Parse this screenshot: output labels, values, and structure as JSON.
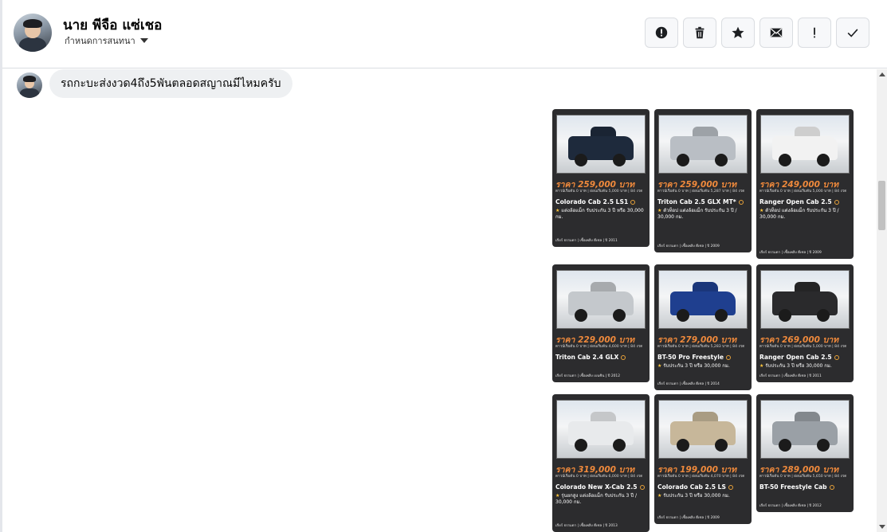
{
  "header": {
    "name": "นาย พีจือ แซ่เชอ",
    "subtitle": "กำหนดการสนทนา"
  },
  "messages": [
    {
      "text": "รถกะบะส่งงวด4ถึง5พันตลอดสญาณมีไหมครับ"
    }
  ],
  "cars": [
    {
      "price": "ราคา 259,000 บาท",
      "finance": "ดาวน์เริ่มต้น 0 บาท | ผ่อนเริ่มต้น 5,000 บาท | 84 งวด",
      "model": "Colorado Cab 2.5 LS1",
      "feature": "แต่งล้อแม็ก รับประกัน 3 ปี หรือ 30,000 กม.",
      "footer": "เกียร์ ธรรมดา | เชื้อเพลิง ดีเซล | ปี 2011",
      "body_color": "#1e2a3c"
    },
    {
      "price": "ราคา 259,000 บาท",
      "finance": "ดาวน์เริ่มต้น 0 บาท | ผ่อนเริ่มต้น 5,287 บาท | 84 งวด",
      "model": "Triton Cab 2.5 GLX MT*",
      "feature": "ตัวท็อป แต่งล้อแม็ก รับประกัน 3 ปี / 30,000 กม.",
      "footer": "เกียร์ ธรรมดา | เชื้อเพลิง ดีเซล | ปี 2009",
      "body_color": "#b9bec4"
    },
    {
      "price": "ราคา 249,000 บาท",
      "finance": "ดาวน์เริ่มต้น 0 บาท | ผ่อนเริ่มต้น 5,000 บาท | 84 งวด",
      "model": "Ranger Open Cab 2.5",
      "feature": "ตัวท็อป แต่งล้อแม็ก รับประกัน 3 ปี / 30,000 กม.",
      "footer": "เกียร์ ธรรมดา | เชื้อเพลิง ดีเซล | ปี 2009",
      "body_color": "#f2f2f2"
    },
    {
      "price": "ราคา 229,000 บาท",
      "finance": "ดาวน์เริ่มต้น 0 บาท | ผ่อนเริ่มต้น 4,600 บาท | 84 งวด",
      "model": "Triton Cab 2.4 GLX",
      "feature": "",
      "footer": "เกียร์ ธรรมดา | เชื้อเพลิง เบนซิน | ปี 2012",
      "body_color": "#c4c8cc"
    },
    {
      "price": "ราคา 279,000 บาท",
      "finance": "ดาวน์เริ่มต้น 0 บาท | ผ่อนเริ่มต้น 5,283 บาท | 84 งวด",
      "model": "BT-50 Pro Freestyle",
      "feature": "รับประกัน 3 ปี หรือ 30,000 กม.",
      "footer": "เกียร์ ธรรมดา | เชื้อเพลิง ดีเซล | ปี 2014",
      "body_color": "#1f3f8f"
    },
    {
      "price": "ราคา 269,000 บาท",
      "finance": "ดาวน์เริ่มต้น 0 บาท | ผ่อนเริ่มต้น 5,000 บาท | 84 งวด",
      "model": "Ranger Open Cab 2.5",
      "feature": "รับประกัน 3 ปี หรือ 30,000 กม.",
      "footer": "เกียร์ ธรรมดา | เชื้อเพลิง ดีเซล | ปี 2011",
      "body_color": "#2a2a2c"
    },
    {
      "price": "ราคา 319,000 บาท",
      "finance": "ดาวน์เริ่มต้น 0 บาท | ผ่อนเริ่มต้น 6,000 บาท | 84 งวด",
      "model": "Colorado New X-Cab 2.5",
      "feature": "รุ่นยกสูง แต่งล้อแม็ก รับประกัน 3 ปี / 30,000 กม.",
      "footer": "เกียร์ ธรรมดา | เชื้อเพลิง ดีเซล | ปี 2013",
      "body_color": "#e8eaec"
    },
    {
      "price": "ราคา 199,000 บาท",
      "finance": "ดาวน์เริ่มต้น 0 บาท | ผ่อนเริ่มต้น 4,070 บาท | 84 งวด",
      "model": "Colorado Cab 2.5 LS",
      "feature": "รับประกัน 3 ปี หรือ 30,000 กม.",
      "footer": "เกียร์ ธรรมดา | เชื้อเพลิง ดีเซล | ปี 2009",
      "body_color": "#c7b79a"
    },
    {
      "price": "ราคา 289,000 บาท",
      "finance": "ดาวน์เริ่มต้น 0 บาท | ผ่อนเริ่มต้น 5,650 บาท | 84 งวด",
      "model": "BT-50 Freestyle Cab",
      "feature": "",
      "footer": "เกียร์ ธรรมดา | เชื้อเพลิง ดีเซล | ปี 2012",
      "body_color": "#9aa0a6"
    }
  ]
}
